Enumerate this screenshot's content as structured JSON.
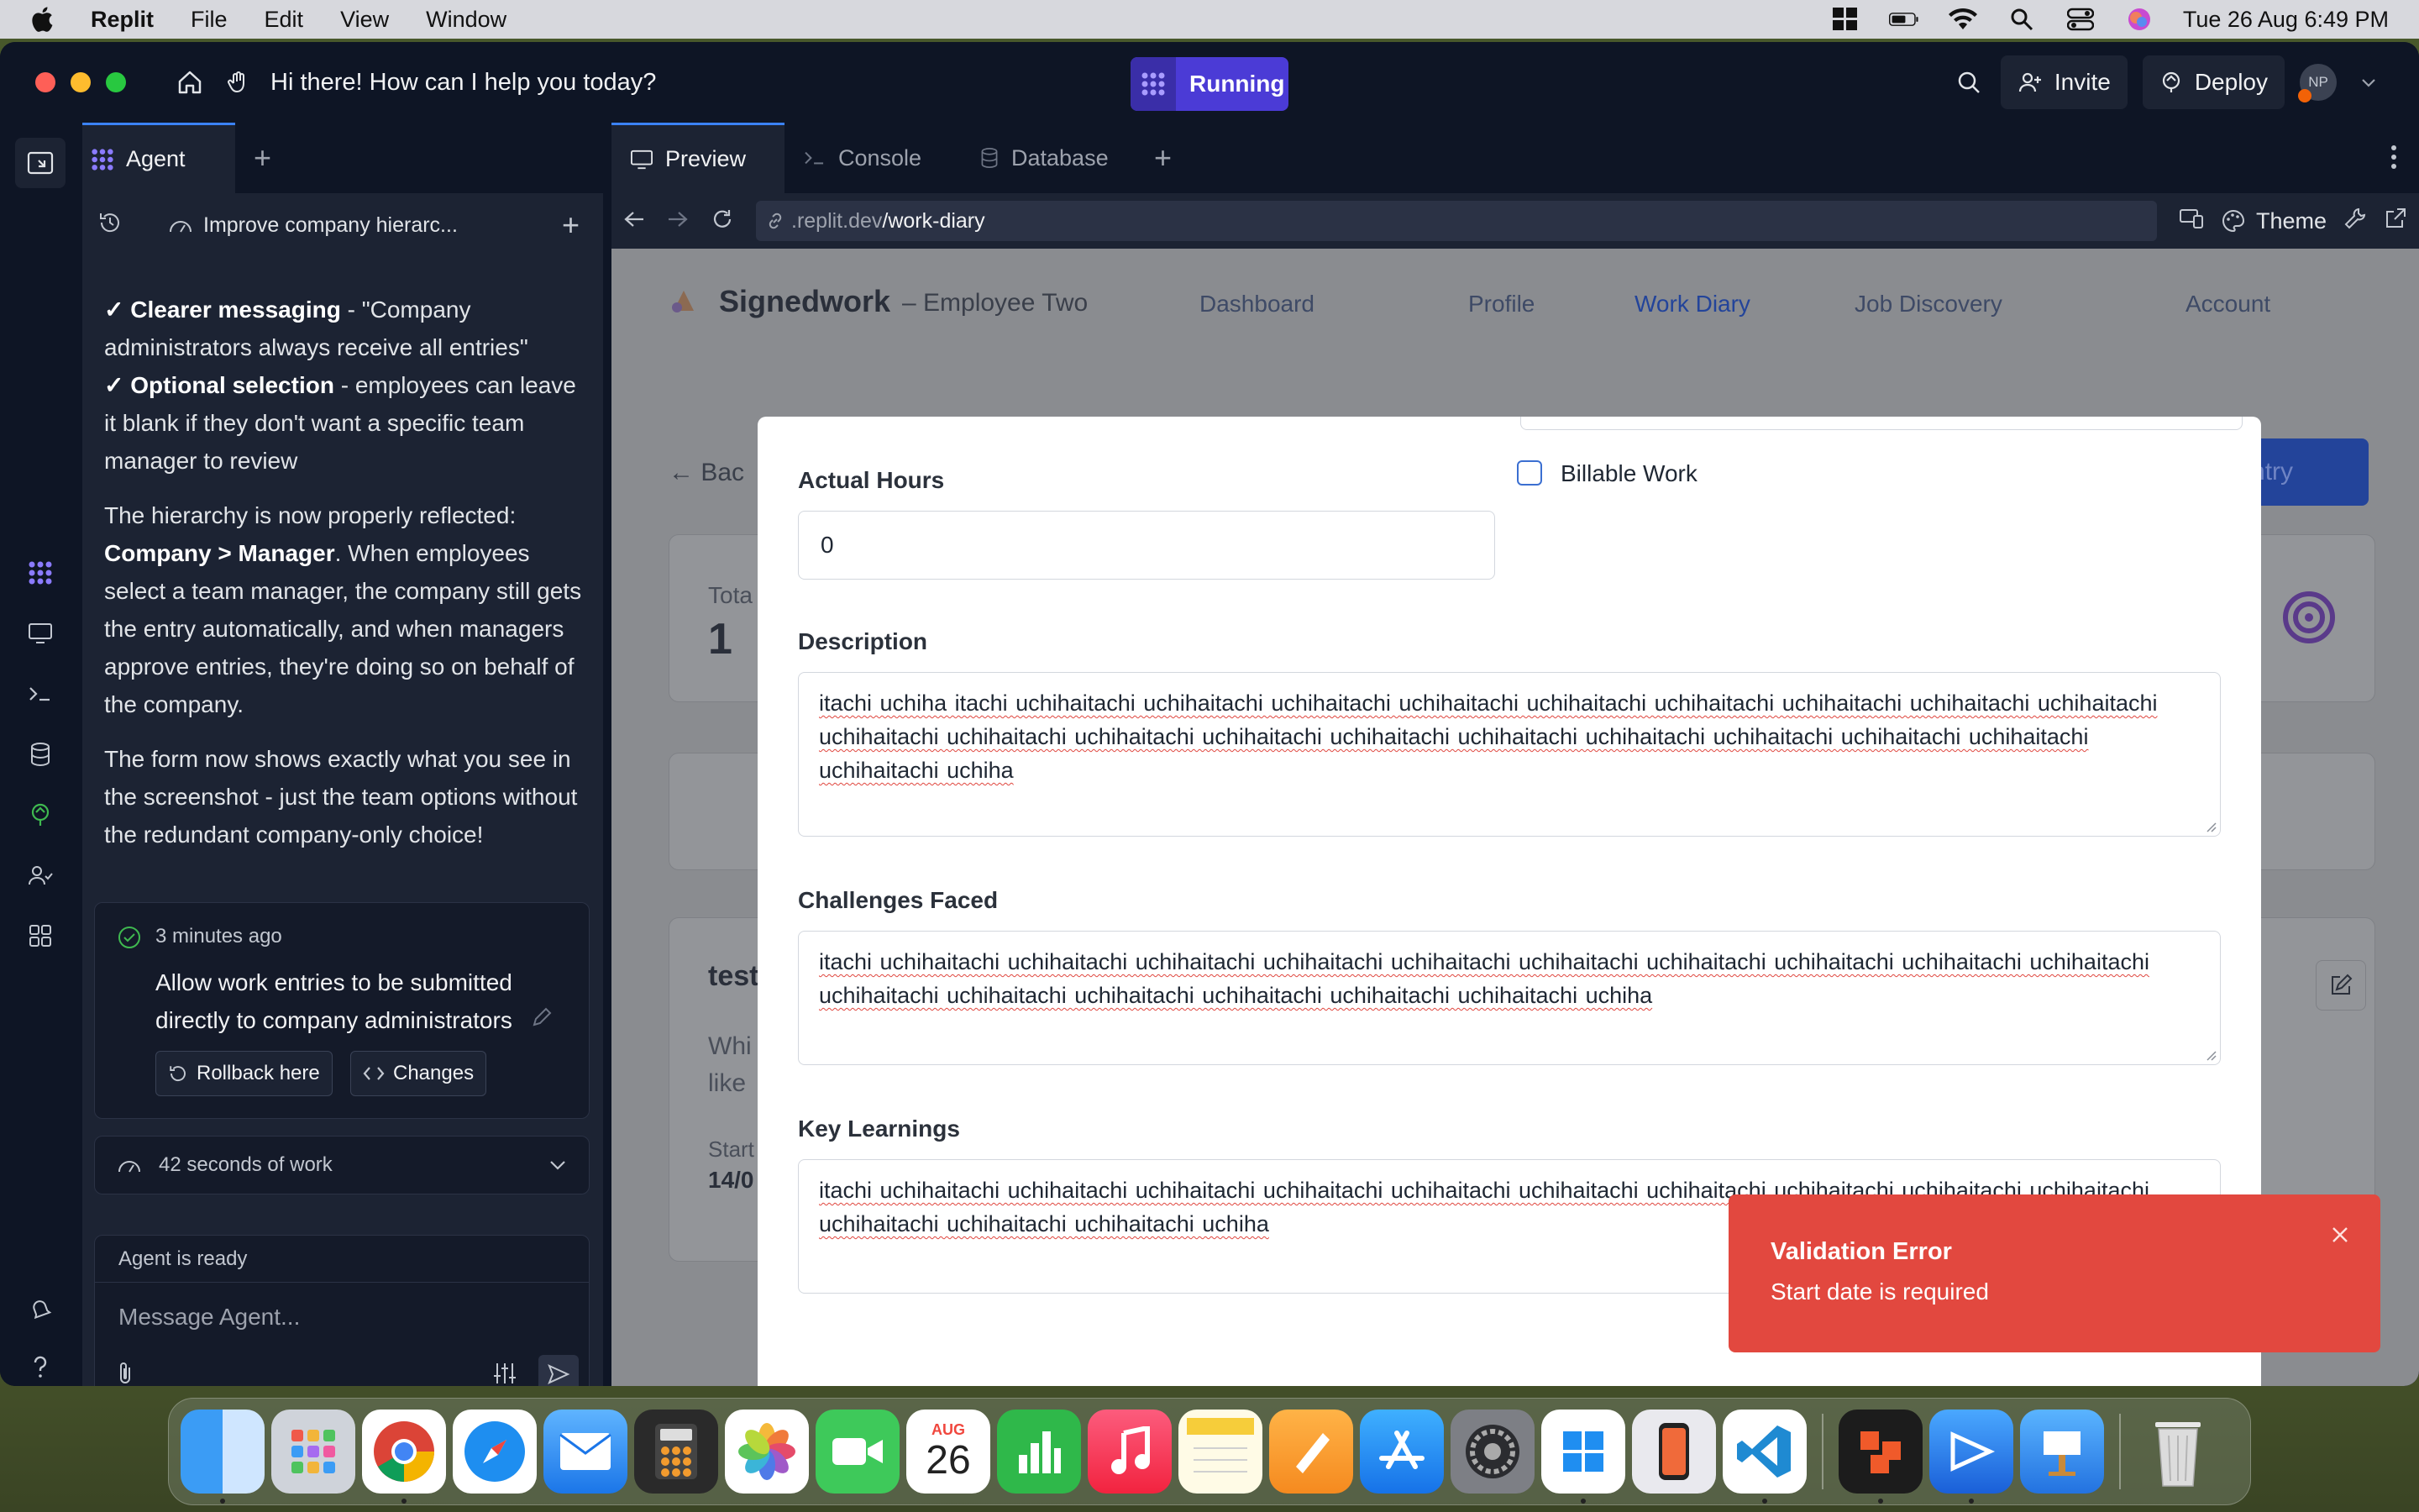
{
  "menubar": {
    "app": "Replit",
    "items": [
      "File",
      "Edit",
      "View",
      "Window"
    ],
    "datetime": "Tue 26 Aug  6:49 PM"
  },
  "titlebar": {
    "greeting": "Hi there! How can I help you today?",
    "running_label": "Running",
    "invite_label": "Invite",
    "deploy_label": "Deploy",
    "avatar_initials": "NP"
  },
  "agent": {
    "tab_label": "Agent",
    "thread_title": "Improve company hierarc...",
    "messages": {
      "line1_bold": "✓ Clearer messaging",
      "line1_rest": " - \"Company administrators always receive all entries\"",
      "line2_bold": "✓ Optional selection",
      "line2_rest": " - employees can leave it blank if they don't want a specific team manager to review",
      "p2_start": "The hierarchy is now properly reflected: ",
      "p2_bold": "Company > Manager",
      "p2_rest": ". When employees select a team manager, the company still gets the entry automatically, and when managers approve entries, they're doing so on behalf of the company.",
      "p3": "The form now shows exactly what you see in the screenshot - just the team options without the redundant company-only choice!"
    },
    "checkpoint": {
      "time": "3 minutes ago",
      "message": "Allow work entries to be submitted directly to company administrators",
      "rollback_label": "Rollback here",
      "changes_label": "Changes"
    },
    "work_summary": "42 seconds of work",
    "composer": {
      "status": "Agent is ready",
      "placeholder": "Message Agent..."
    }
  },
  "workspace": {
    "tabs": [
      "Preview",
      "Console",
      "Database"
    ],
    "url_dim": ".replit.dev",
    "url_path": "/work-diary",
    "theme_label": "Theme"
  },
  "background_app": {
    "logo": "Signedwork",
    "subtitle": "– Employee Two",
    "nav": [
      "Dashboard",
      "Profile",
      "Work Diary",
      "Job Discovery",
      "Account"
    ],
    "back_label": "← Bac",
    "entry_btn": "Entry",
    "total_label": "Tota",
    "total_value": "1",
    "card_title": "test",
    "card_text1": "Whi",
    "card_text2": "like",
    "start_label": "Start",
    "start_value": "14/0"
  },
  "form": {
    "actual_hours_label": "Actual Hours",
    "actual_hours_value": "0",
    "billable_label": "Billable Work",
    "description_label": "Description",
    "description_value": "itachi uchiha itachi uchihaitachi uchihaitachi uchihaitachi uchihaitachi uchihaitachi uchihaitachi uchihaitachi uchihaitachi uchihaitachi uchihaitachi uchihaitachi uchihaitachi uchihaitachi uchihaitachi uchihaitachi uchihaitachi uchihaitachi uchihaitachi uchihaitachi uchihaitachi uchiha",
    "challenges_label": "Challenges Faced",
    "challenges_value": "itachi uchihaitachi uchihaitachi uchihaitachi uchihaitachi uchihaitachi uchihaitachi uchihaitachi uchihaitachi uchihaitachi uchihaitachi uchihaitachi uchihaitachi uchihaitachi uchihaitachi uchihaitachi uchihaitachi uchiha",
    "learnings_label": "Key Learnings",
    "learnings_value": "itachi uchihaitachi uchihaitachi uchihaitachi uchihaitachi uchihaitachi uchihaitachi uchihaitachi uchihaitachi uchihaitachi uchihaitachi uchihaitachi uchihaitachi uchihaitachi uchiha"
  },
  "toast": {
    "title": "Validation Error",
    "message": "Start date is required"
  },
  "dock": {
    "calendar_month": "AUG",
    "calendar_day": "26",
    "apps": [
      "finder-icon",
      "launchpad-icon",
      "chrome-icon",
      "safari-icon",
      "mail-icon",
      "calculator-icon",
      "photos-icon",
      "facetime-icon",
      "calendar-icon",
      "numbers-icon",
      "music-icon",
      "notes-icon",
      "pages-icon",
      "app-store-icon",
      "system-settings-icon",
      "windows-app-icon",
      "iphone-mirroring-icon",
      "vscode-icon",
      "office-icon",
      "remote-desktop-icon",
      "keynote-icon",
      "trash-icon"
    ]
  },
  "colors": {
    "accent": "#4b3bd6",
    "toast_bg": "#e2483f",
    "panel_bg": "#1c2333",
    "app_bg": "#0e1525"
  }
}
